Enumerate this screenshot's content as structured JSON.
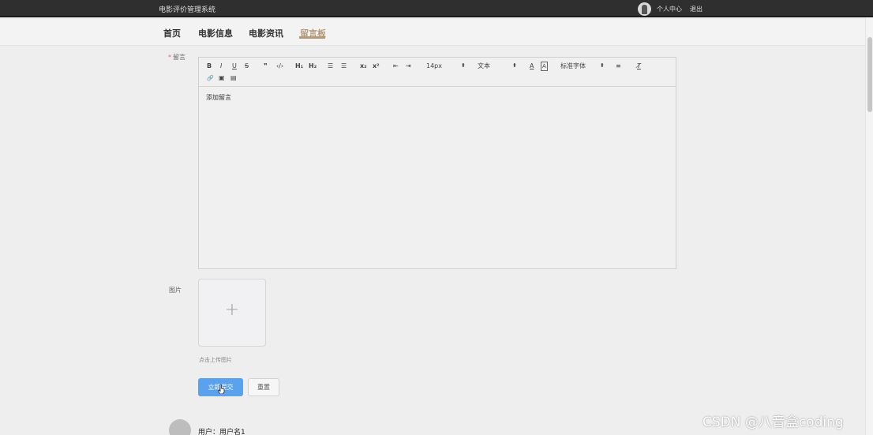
{
  "header": {
    "site_title": "电影评价管理系统",
    "user_center": "个人中心",
    "logout": "退出"
  },
  "nav": {
    "items": [
      {
        "label": "首页",
        "active": false
      },
      {
        "label": "电影信息",
        "active": false
      },
      {
        "label": "电影资讯",
        "active": false
      },
      {
        "label": "留言板",
        "active": true
      }
    ],
    "active_color": "#b59a7a"
  },
  "form": {
    "message_label": "留言",
    "required_mark": "*",
    "toolbar": {
      "bold": "B",
      "italic": "I",
      "underline": "U",
      "strike": "S",
      "blockquote": "❞",
      "code": "‹/›",
      "h1": "H₁",
      "h2": "H₂",
      "ordered_list": "☰",
      "bullet_list": "☰",
      "subscript": "x₂",
      "superscript": "x²",
      "indent_decrease": "⇤",
      "indent_increase": "⇥",
      "font_size": "14px",
      "block_type": "文本",
      "font_color": "A",
      "background_color": "A",
      "font_family": "标准字体",
      "align": "≡",
      "clear_format": "T̸",
      "link": "🔗",
      "image": "▣",
      "video": "▤"
    },
    "editor_content": "添加留言",
    "image_label": "图片",
    "upload_plus": "+",
    "upload_hint": "点击上传图片",
    "submit_label": "立即提交",
    "reset_label": "重置"
  },
  "comment": {
    "user_line": "用户：用户名1"
  },
  "watermark": "CSDN @八音盒coding"
}
